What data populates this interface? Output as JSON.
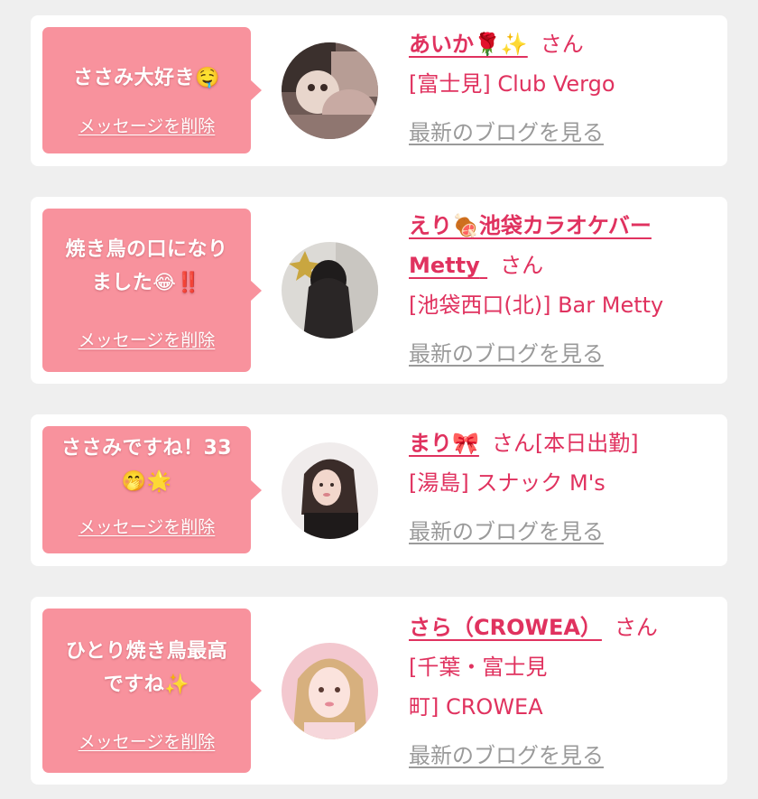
{
  "messages": [
    {
      "bubble_text": "ささみ大好き🤤",
      "delete_label": "メッセージを削除",
      "name": "あいか🌹✨",
      "san": "さん",
      "status": "",
      "shop": "[富士見] Club Vergo",
      "blog_label": "最新のブログを見る"
    },
    {
      "bubble_line1": "焼き鳥の口になり",
      "bubble_line2": "ました😂‼️",
      "delete_label": "メッセージを削除",
      "name_line1": "えり🍖池袋カラオケバー",
      "name_line2": "Metty",
      "san": "さん",
      "shop": "[池袋西口(北)] Bar Metty",
      "blog_label": "最新のブログを見る"
    },
    {
      "bubble_line1": "ささみですね！33",
      "bubble_line2": "🤭🌟",
      "delete_label": "メッセージを削除",
      "name": "まり🎀",
      "san": "さん",
      "status": "[本日出勤]",
      "shop": "[湯島] スナック M's",
      "blog_label": "最新のブログを見る"
    },
    {
      "bubble_line1": "ひとり焼き鳥最高",
      "bubble_line2": "ですね✨",
      "delete_label": "メッセージを削除",
      "name": "さら（CROWEA）",
      "san": "さん",
      "shop_line1": "[千葉・富士見",
      "shop_line2": "町] CROWEA",
      "blog_label": "最新のブログを見る"
    }
  ],
  "colors": {
    "bubble": "#f8929d",
    "accent": "#e0325f",
    "muted_link": "#9a9a9a",
    "background": "#efefef"
  }
}
